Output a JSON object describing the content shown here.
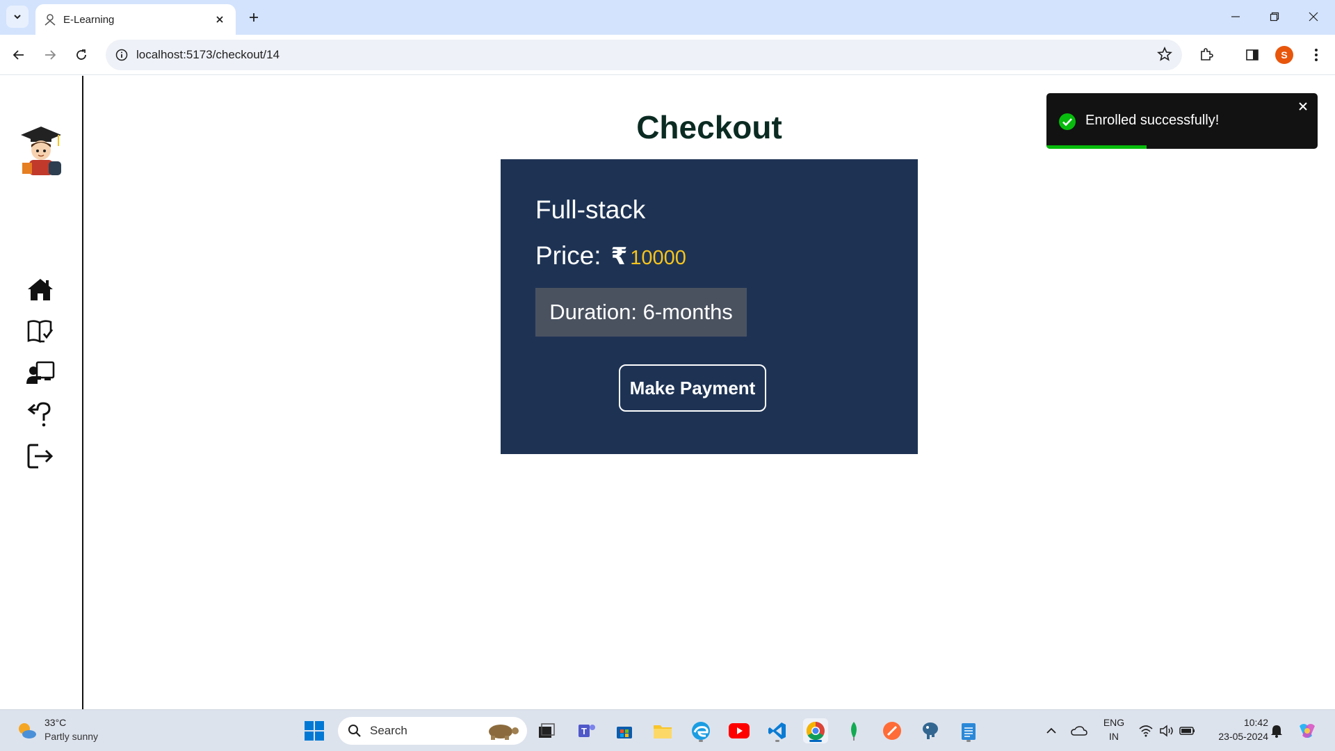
{
  "browser": {
    "tab_title": "E-Learning",
    "url": "localhost:5173/checkout/14",
    "profile_initial": "S"
  },
  "page": {
    "title": "Checkout"
  },
  "sidebar": {
    "items": [
      {
        "icon": "home-icon"
      },
      {
        "icon": "book-check-icon"
      },
      {
        "icon": "teacher-icon"
      },
      {
        "icon": "help-icon"
      },
      {
        "icon": "logout-icon"
      }
    ]
  },
  "course": {
    "name": "Full-stack",
    "price_label": "Price:",
    "currency_symbol": "₹",
    "price": "10000",
    "duration": "Duration: 6-months",
    "pay_button": "Make Payment"
  },
  "toast": {
    "message": "Enrolled successfully!",
    "progress": 0.37,
    "type": "success"
  },
  "taskbar": {
    "weather_temp": "33°C",
    "weather_desc": "Partly sunny",
    "search_label": "Search",
    "lang_top": "ENG",
    "lang_bottom": "IN",
    "time": "10:42",
    "date": "23-05-2024"
  },
  "colors": {
    "card_bg": "#1e3354",
    "price": "#f6c41c",
    "title": "#0b2b22",
    "toast_bg": "#121212",
    "toast_progress": "#07bc0c"
  }
}
